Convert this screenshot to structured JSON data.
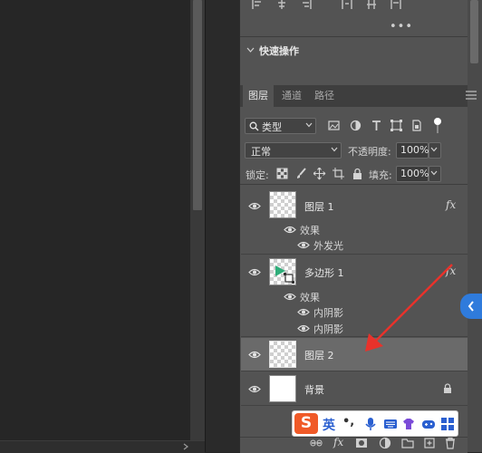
{
  "panel": {
    "quick_actions_title": "快速操作",
    "more_label": "•••"
  },
  "layers_panel": {
    "tabs": [
      "图层",
      "通道",
      "路径"
    ],
    "filter_kind": "类型",
    "blend_mode": "正常",
    "opacity_label": "不透明度:",
    "opacity_value": "100%",
    "lock_label": "锁定:",
    "fill_label": "填充:",
    "fill_value": "100%",
    "layers": [
      {
        "name": "图层 1",
        "fx": "fx",
        "effects_label": "效果",
        "effects": [
          "外发光"
        ]
      },
      {
        "name": "多边形 1",
        "fx": "fx",
        "effects_label": "效果",
        "effects": [
          "内阴影",
          "内阴影"
        ]
      },
      {
        "name": "图层 2",
        "selected": true
      },
      {
        "name": "背景",
        "locked": true
      }
    ]
  },
  "bottom_bar": {
    "fx_label": "fx"
  },
  "ime": {
    "lang": "英",
    "punct": "•,",
    "logo": "S"
  },
  "colors": {
    "arrow": "#e8322b",
    "side_tab": "#2f7bdc",
    "ime_logo": "#f05a28"
  }
}
